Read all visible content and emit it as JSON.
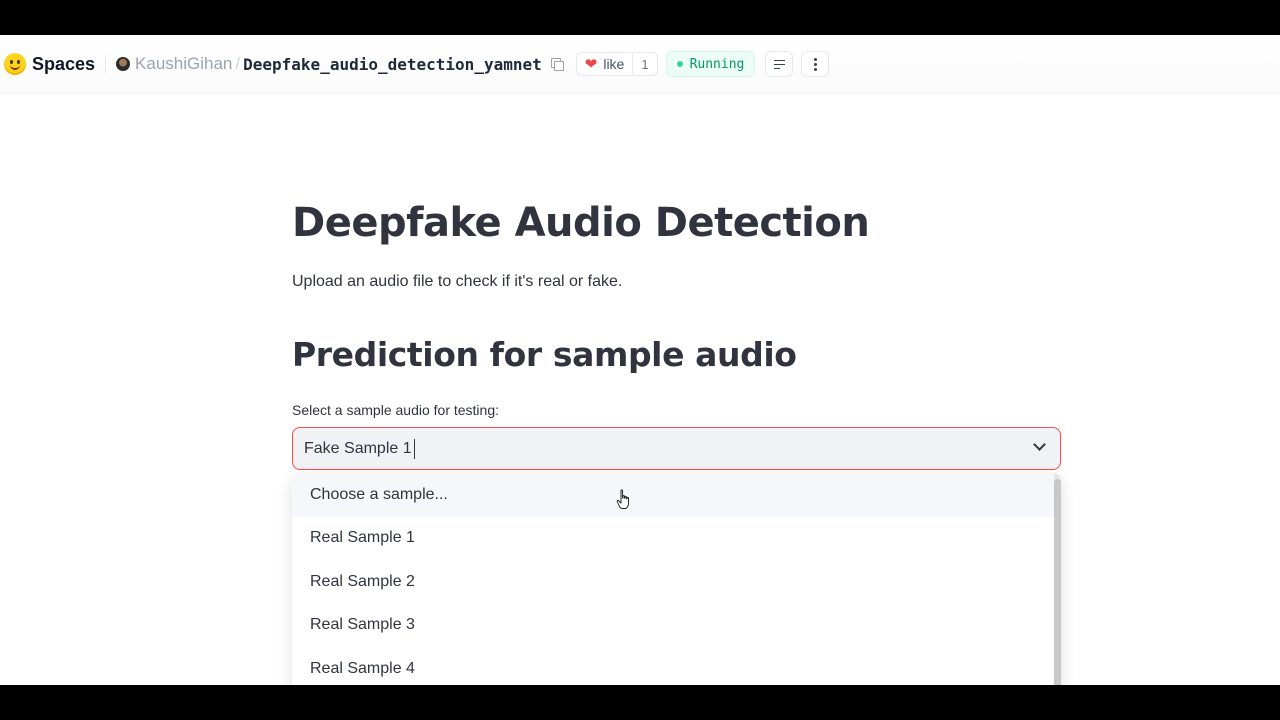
{
  "header": {
    "spaces_label": "Spaces",
    "owner": "KaushiGihan",
    "separator": "/",
    "repo_name": "Deepfake_audio_detection_yamnet",
    "like_label": "like",
    "like_count": "1",
    "status": "Running",
    "icons": [
      "hf-logo-icon",
      "user-avatar",
      "copy-icon",
      "heart-icon",
      "list-icon",
      "more-vertical-icon"
    ]
  },
  "main": {
    "title": "Deepfake Audio Detection",
    "subtitle": "Upload an audio file to check if it's real or fake.",
    "section_title": "Prediction for sample audio",
    "select_label": "Select a sample audio for testing:",
    "select_value": "Fake Sample 1",
    "options": [
      "Choose a sample...",
      "Real Sample 1",
      "Real Sample 2",
      "Real Sample 3",
      "Real Sample 4"
    ]
  },
  "colors": {
    "accent_border": "#ff4b4b",
    "status_green": "#059669",
    "text": "#31333f"
  }
}
